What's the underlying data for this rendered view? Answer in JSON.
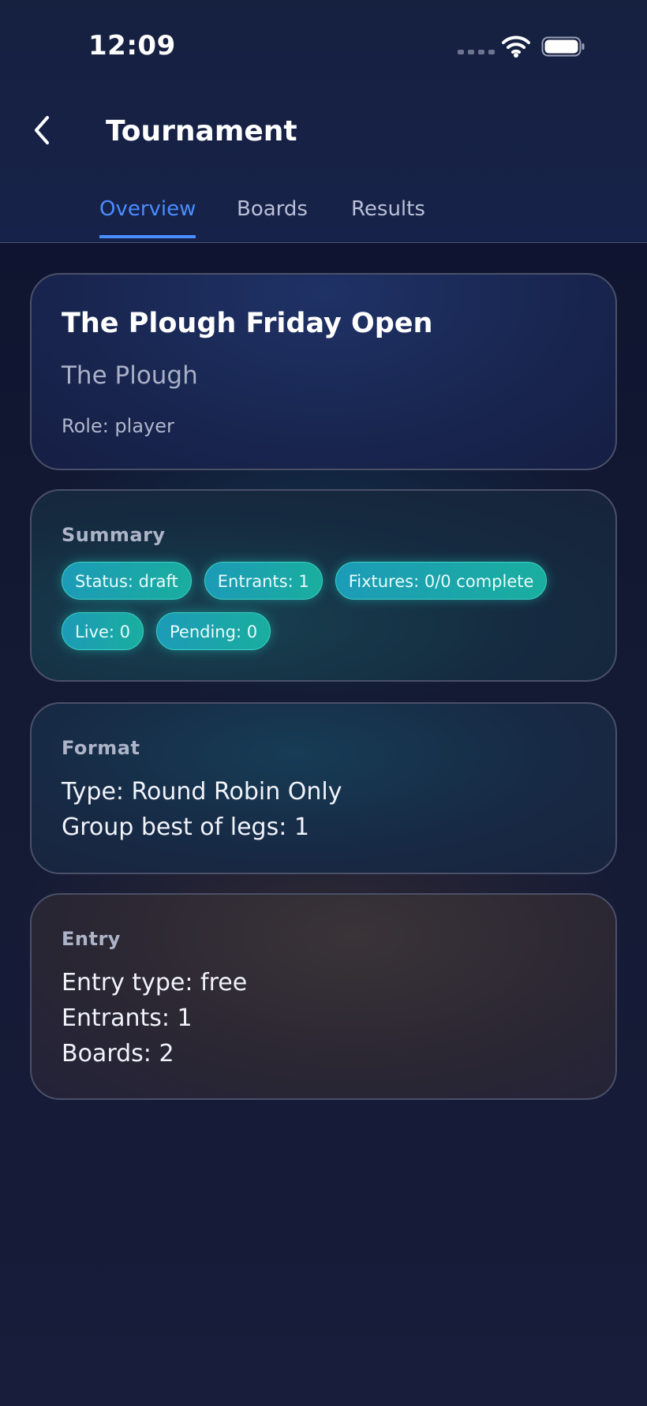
{
  "status_bar": {
    "time": "12:09",
    "wifi_icon": "wifi-icon",
    "battery_icon": "battery-icon"
  },
  "header": {
    "back_icon": "chevron-left-icon",
    "title": "Tournament"
  },
  "tabs": [
    {
      "label": "Overview",
      "active": true
    },
    {
      "label": "Boards",
      "active": false
    },
    {
      "label": "Results",
      "active": false
    }
  ],
  "tournament": {
    "name": "The Plough Friday Open",
    "venue": "The Plough",
    "role": "Role: player"
  },
  "summary": {
    "heading": "Summary",
    "chips": [
      "Status: draft",
      "Entrants: 1",
      "Fixtures: 0/0 complete",
      "Live: 0",
      "Pending: 0"
    ]
  },
  "format": {
    "heading": "Format",
    "lines": [
      "Type: Round Robin Only",
      "Group best of legs: 1"
    ]
  },
  "entry": {
    "heading": "Entry",
    "lines": [
      "Entry type: free",
      "Entrants: 1",
      "Boards: 2"
    ]
  },
  "colors": {
    "accent": "#4a8dff",
    "chip": "#1ba6a8",
    "background": "#171d3a"
  }
}
